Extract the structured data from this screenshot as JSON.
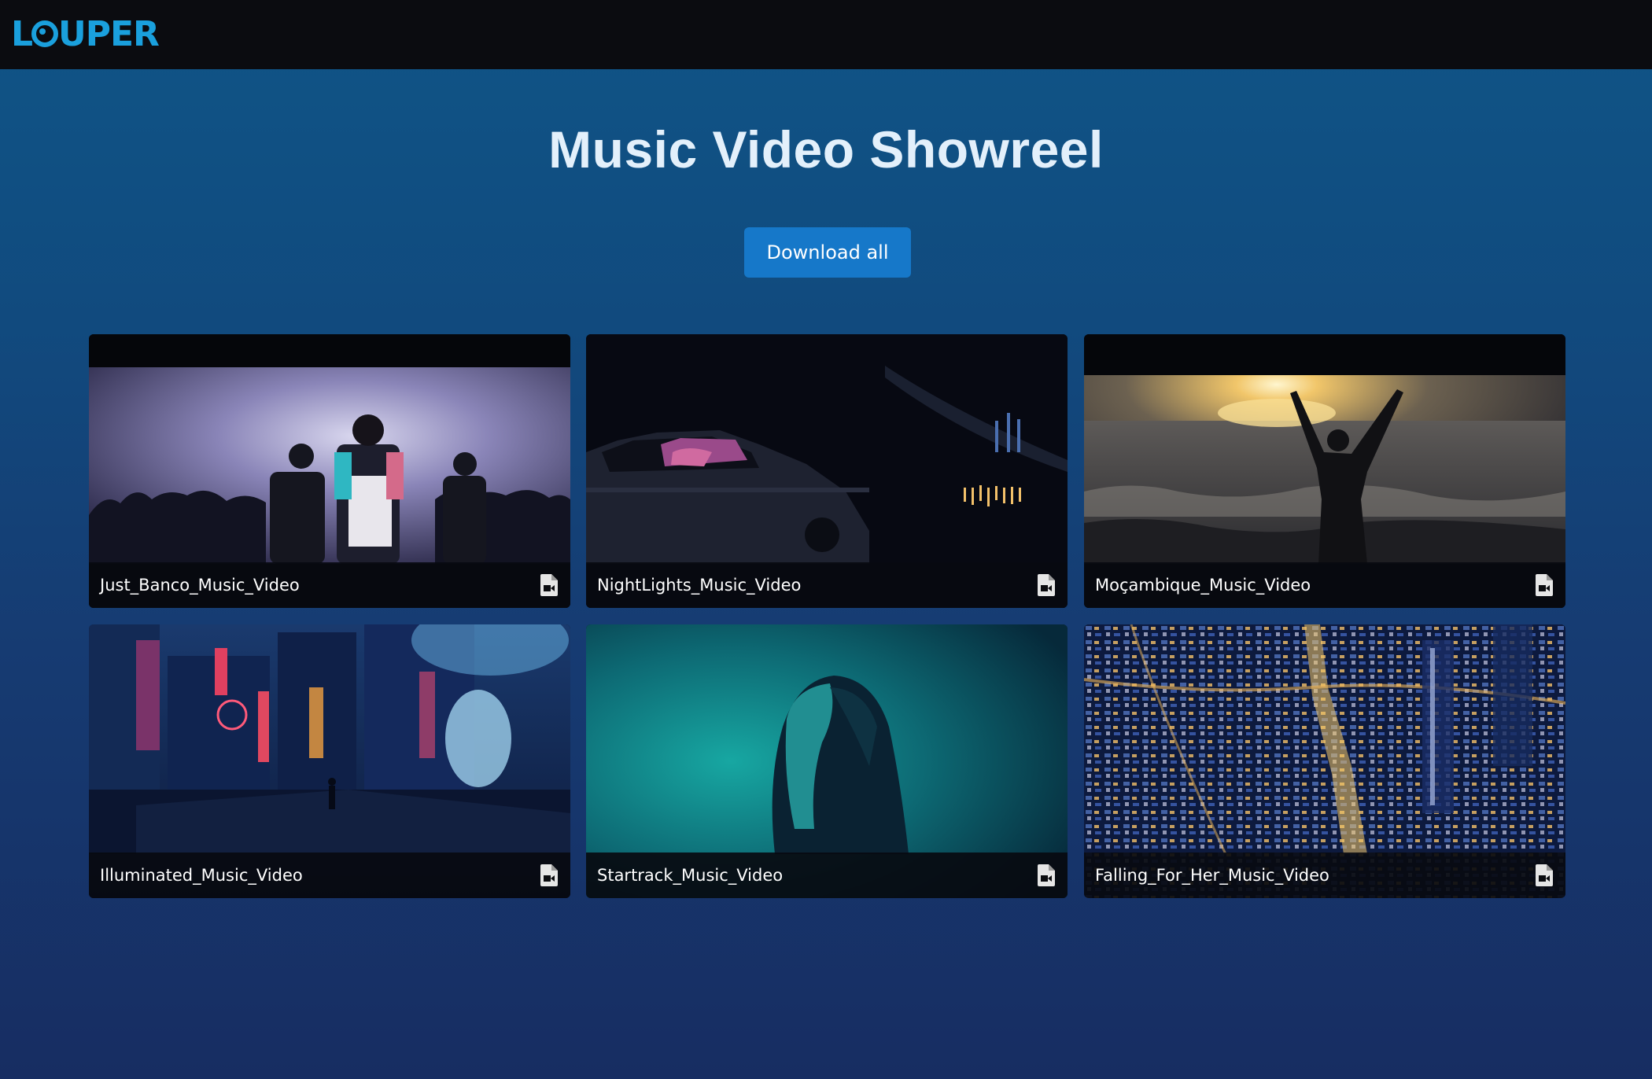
{
  "header": {
    "logo_text": "LOUPER",
    "logo_color": "#1aa0dd"
  },
  "page": {
    "title": "Music Video Showreel",
    "download_label": "Download all",
    "accent_color": "#1678c9"
  },
  "videos": [
    {
      "name": "Just_Banco_Music_Video",
      "icon": "video-file-icon"
    },
    {
      "name": "NightLights_Music_Video",
      "icon": "video-file-icon"
    },
    {
      "name": "Moçambique_Music_Video",
      "icon": "video-file-icon"
    },
    {
      "name": "Illuminated_Music_Video",
      "icon": "video-file-icon"
    },
    {
      "name": "Startrack_Music_Video",
      "icon": "video-file-icon"
    },
    {
      "name": "Falling_For_Her_Music_Video",
      "icon": "video-file-icon"
    }
  ]
}
